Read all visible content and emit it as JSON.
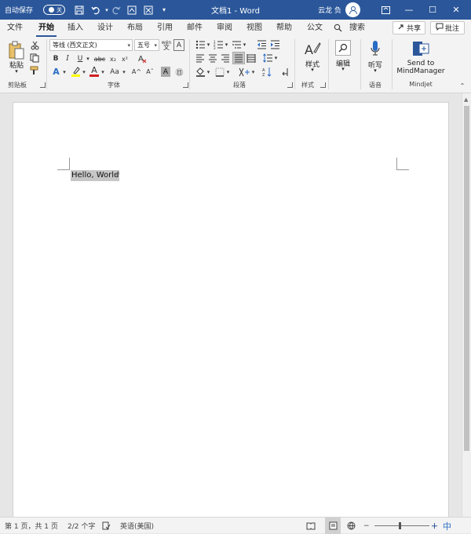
{
  "titlebar": {
    "autosave_label": "自动保存",
    "autosave_state": "关",
    "doc_title": "文档1 - Word",
    "user_name": "云龙 负",
    "minimize": "—",
    "restore": "☐",
    "close": "✕"
  },
  "tabs": [
    "文件",
    "开始",
    "插入",
    "设计",
    "布局",
    "引用",
    "邮件",
    "审阅",
    "视图",
    "帮助",
    "公文",
    "搜索"
  ],
  "active_tab": "开始",
  "share_label": "共享",
  "comment_label": "批注",
  "clipboard": {
    "paste_label": "粘贴",
    "group_label": "剪贴板"
  },
  "font": {
    "font_name": "等线 (西文正文)",
    "font_size": "五号",
    "wen_label": "wén",
    "bold": "B",
    "italic": "I",
    "underline": "U",
    "strike": "abc",
    "sub": "x₂",
    "sup": "x²",
    "text_effect": "A",
    "font_color": "A",
    "change_case": "Aa",
    "grow": "A^",
    "shrink": "Aˇ",
    "char_shade": "A",
    "enclose": "㊐",
    "group_label": "字体"
  },
  "paragraph": {
    "group_label": "段落"
  },
  "styles": {
    "label": "样式",
    "group_label": "样式"
  },
  "editing": {
    "label": "编辑"
  },
  "voice": {
    "label": "听写",
    "group_label": "语音"
  },
  "mindjet": {
    "line1": "Send to",
    "line2": "MindManager",
    "group_label": "Mindjet"
  },
  "document": {
    "text": "Hello, World",
    "para_mark": "↵"
  },
  "statusbar": {
    "page": "第 1 页，共 1 页",
    "words": "2/2 个字",
    "language": "英语(美国)",
    "ime": "中"
  }
}
